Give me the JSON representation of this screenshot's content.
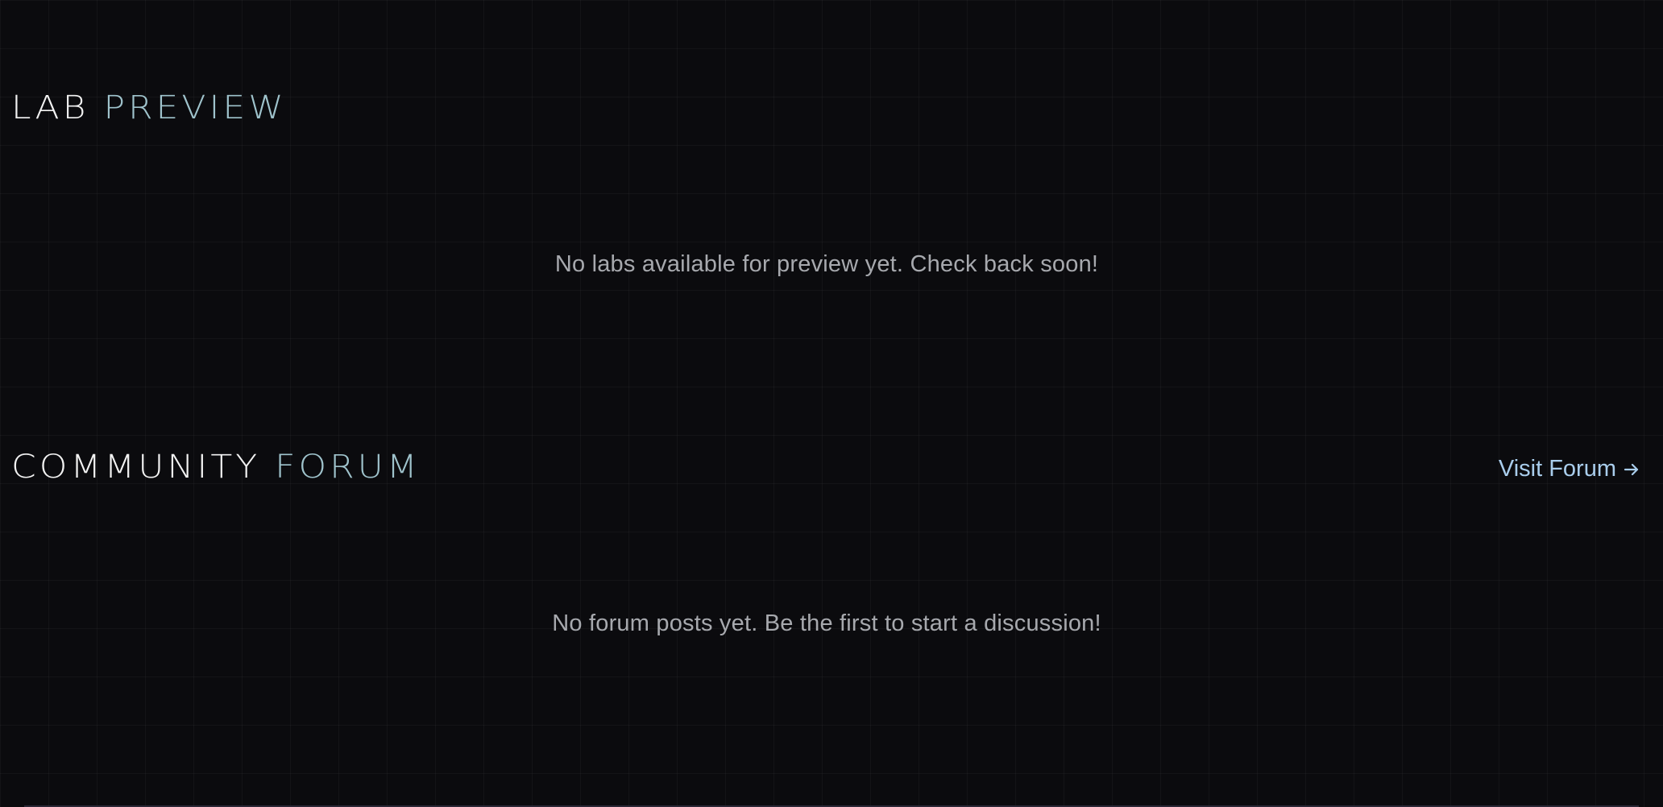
{
  "lab_preview": {
    "heading_primary": "LAB",
    "heading_accent": "PREVIEW",
    "empty_message": "No labs available for preview yet. Check back soon!"
  },
  "community_forum": {
    "heading_primary": "COMMUNITY",
    "heading_accent": "FORUM",
    "visit_link_label": "Visit Forum",
    "visit_link_icon": "arrow-right-icon",
    "empty_message": "No forum posts yet. Be the first to start a discussion!"
  },
  "colors": {
    "background": "#0b0b0e",
    "heading_primary": "#f2f2f2",
    "heading_accent": "#9fc3cc",
    "body_text": "#a7a9ae",
    "link": "#a9cdec"
  }
}
